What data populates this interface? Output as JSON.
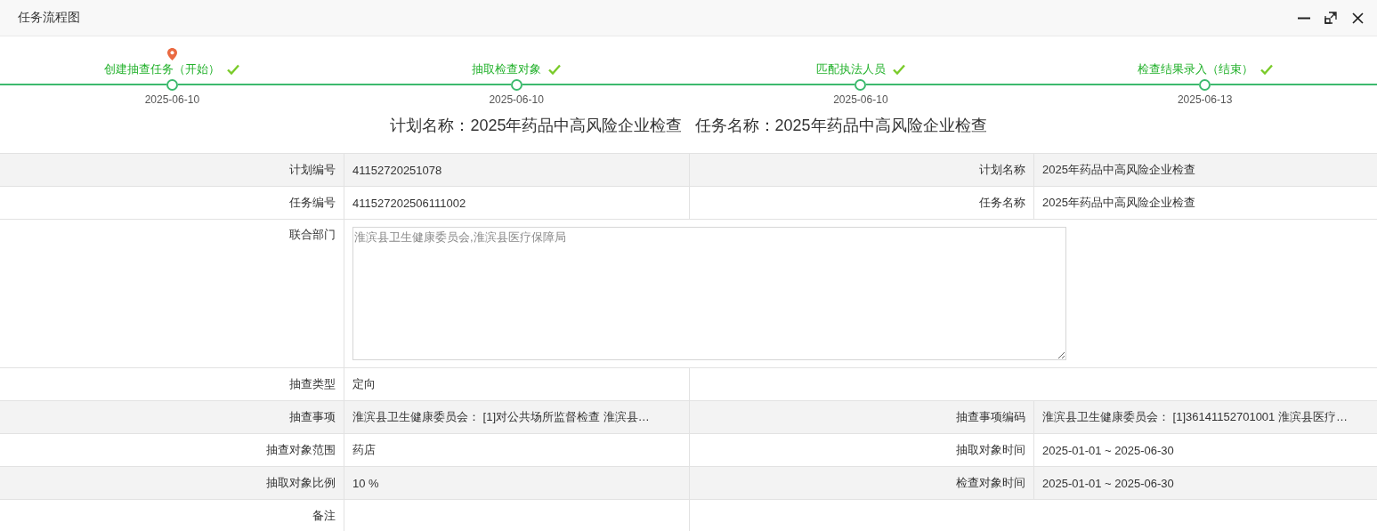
{
  "window": {
    "title": "任务流程图"
  },
  "steps": [
    {
      "label": "创建抽查任务（开始）",
      "date": "2025-06-10",
      "current": true,
      "done": true
    },
    {
      "label": "抽取检查对象",
      "date": "2025-06-10",
      "current": false,
      "done": true
    },
    {
      "label": "匹配执法人员",
      "date": "2025-06-10",
      "current": false,
      "done": true
    },
    {
      "label": "检查结果录入（结束）",
      "date": "2025-06-13",
      "current": false,
      "done": true
    }
  ],
  "heading": [
    "计划名称：2025年药品中高风险企业检查",
    "任务名称：2025年药品中高风险企业检查"
  ],
  "rows": [
    {
      "kind": "pair",
      "shaded": true,
      "fields": [
        {
          "label": "计划编号",
          "value": "41152720251078"
        },
        {
          "label": "计划名称",
          "value": "2025年药品中高风险企业检查"
        }
      ]
    },
    {
      "kind": "pair",
      "shaded": false,
      "fields": [
        {
          "label": "任务编号",
          "value": "411527202506111002"
        },
        {
          "label": "任务名称",
          "value": "2025年药品中高风险企业检查"
        }
      ]
    },
    {
      "kind": "textarea",
      "shaded": false,
      "fields": [
        {
          "label": "联合部门",
          "value": "淮滨县卫生健康委员会,淮滨县医疗保障局"
        }
      ]
    },
    {
      "kind": "single",
      "shaded": false,
      "fields": [
        {
          "label": "抽查类型",
          "value": "定向"
        }
      ]
    },
    {
      "kind": "pair",
      "shaded": true,
      "fields": [
        {
          "label": "抽查事项",
          "value": "淮滨县卫生健康委员会： [1]对公共场所监督检查 淮滨县…"
        },
        {
          "label": "抽查事项编码",
          "value": "淮滨县卫生健康委员会： [1]36141152701001 淮滨县医疗…"
        }
      ]
    },
    {
      "kind": "pair",
      "shaded": false,
      "fields": [
        {
          "label": "抽查对象范围",
          "value": "药店"
        },
        {
          "label": "抽取对象时间",
          "value": "2025-01-01 ~ 2025-06-30"
        }
      ]
    },
    {
      "kind": "pair",
      "shaded": true,
      "fields": [
        {
          "label": "抽取对象比例",
          "value": "10 %"
        },
        {
          "label": "检查对象时间",
          "value": "2025-01-01 ~ 2025-06-30"
        }
      ]
    },
    {
      "kind": "single",
      "shaded": false,
      "fields": [
        {
          "label": "备注"
        }
      ]
    }
  ]
}
